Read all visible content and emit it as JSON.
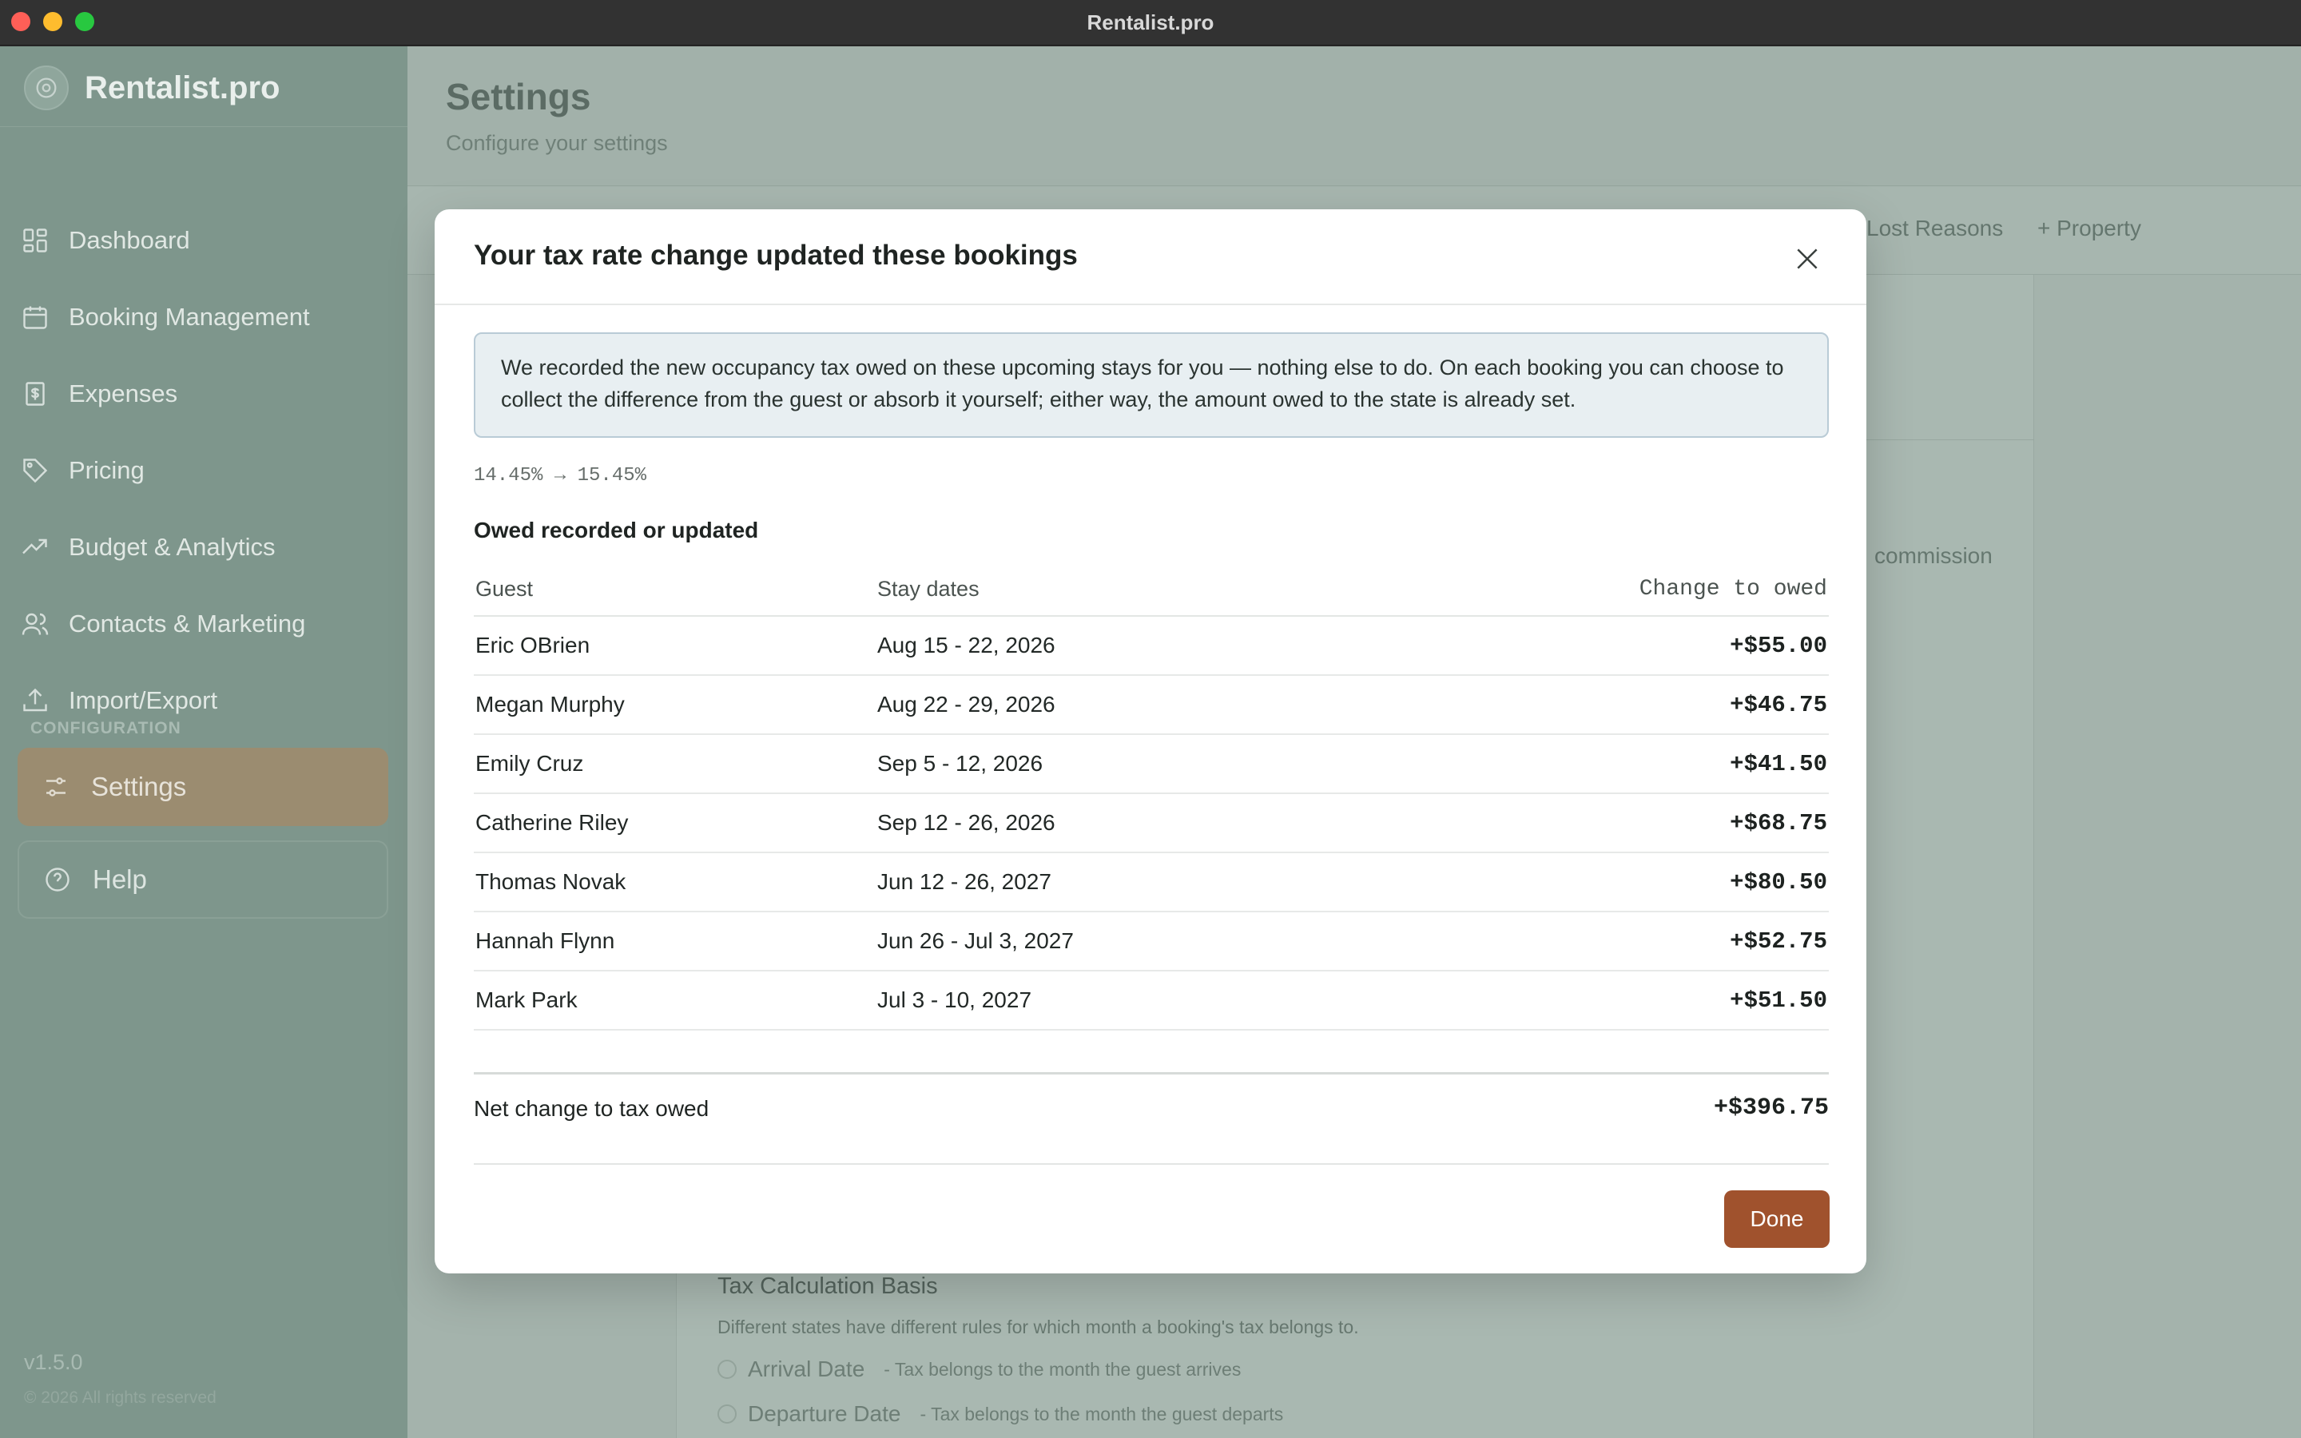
{
  "window": {
    "title": "Rentalist.pro"
  },
  "sidebar": {
    "brand": "Rentalist.pro",
    "items": [
      {
        "label": "Dashboard",
        "icon": "dashboard-icon"
      },
      {
        "label": "Booking Management",
        "icon": "calendar-icon"
      },
      {
        "label": "Expenses",
        "icon": "receipt-icon"
      },
      {
        "label": "Pricing",
        "icon": "tag-icon"
      },
      {
        "label": "Budget & Analytics",
        "icon": "trend-icon"
      },
      {
        "label": "Contacts & Marketing",
        "icon": "contacts-icon"
      },
      {
        "label": "Import/Export",
        "icon": "upload-icon"
      }
    ],
    "section_label": "CONFIGURATION",
    "settings_label": "Settings",
    "help_label": "Help",
    "version": "v1.5.0",
    "copyright": "© 2026 All rights reserved"
  },
  "page": {
    "title": "Settings",
    "subtitle": "Configure your settings",
    "tabs_visible": [
      "Lost Reasons",
      "+ Property"
    ],
    "bg_commission_text": "commission",
    "tax_basis": {
      "title": "Tax Calculation Basis",
      "description": "Different states have different rules for which month a booking's tax belongs to.",
      "options": [
        {
          "label": "Arrival Date",
          "desc": "- Tax belongs to the month the guest arrives"
        },
        {
          "label": "Departure Date",
          "desc": "- Tax belongs to the month the guest departs"
        }
      ]
    }
  },
  "modal": {
    "title": "Your tax rate change updated these bookings",
    "info": "We recorded the new occupancy tax owed on these upcoming stays for you — nothing else to do. On each booking you can choose to collect the difference from the guest or absorb it yourself; either way, the amount owed to the state is already set.",
    "rate_change": "14.45% → 15.45%",
    "section_title": "Owed recorded or updated",
    "columns": {
      "guest": "Guest",
      "dates": "Stay dates",
      "change": "Change to owed"
    },
    "rows": [
      {
        "guest": "Eric OBrien",
        "dates": "Aug 15 - 22, 2026",
        "change": "+$55.00"
      },
      {
        "guest": "Megan Murphy",
        "dates": "Aug 22 - 29, 2026",
        "change": "+$46.75"
      },
      {
        "guest": "Emily Cruz",
        "dates": "Sep 5 - 12, 2026",
        "change": "+$41.50"
      },
      {
        "guest": "Catherine Riley",
        "dates": "Sep 12 - 26, 2026",
        "change": "+$68.75"
      },
      {
        "guest": "Thomas Novak",
        "dates": "Jun 12 - 26, 2027",
        "change": "+$80.50"
      },
      {
        "guest": "Hannah Flynn",
        "dates": "Jun 26 - Jul 3, 2027",
        "change": "+$52.75"
      },
      {
        "guest": "Mark Park",
        "dates": "Jul 3 - 10, 2027",
        "change": "+$51.50"
      }
    ],
    "total_label": "Net change to tax owed",
    "total_value": "+$396.75",
    "done_label": "Done"
  },
  "colors": {
    "accent": "#a0522d",
    "sidebar": "#7e968c",
    "active_nav": "#9b8c70"
  }
}
